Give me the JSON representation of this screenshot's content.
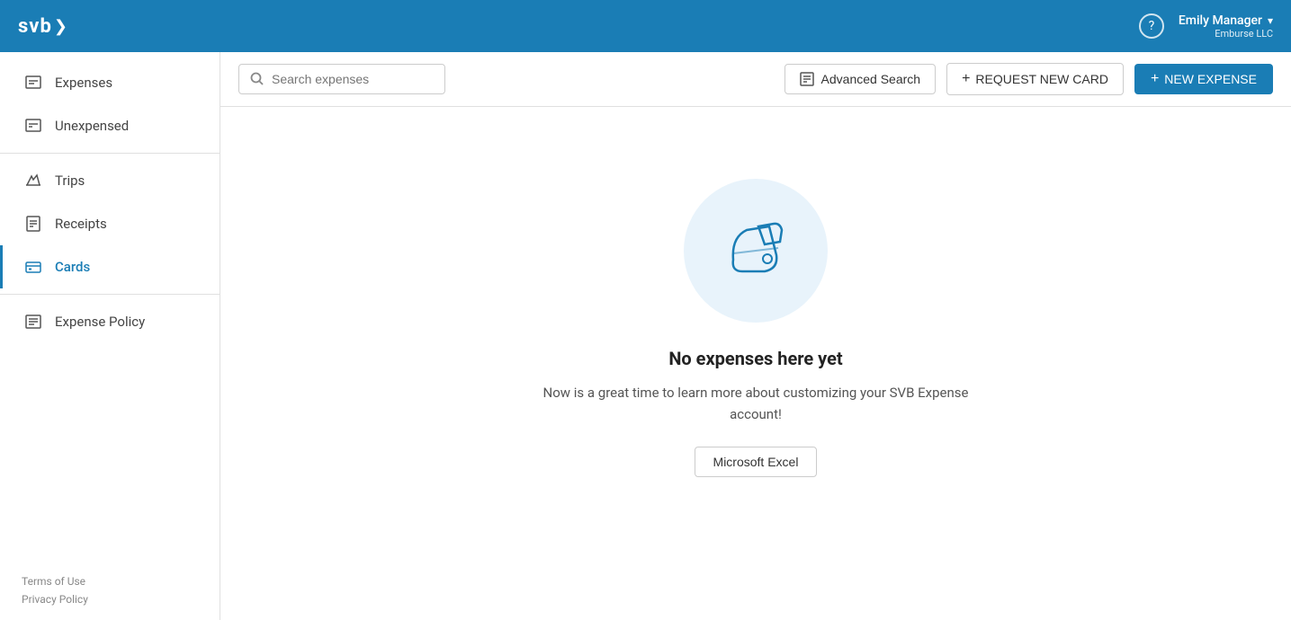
{
  "app": {
    "logo": "svb",
    "logo_chevron": "❯"
  },
  "topnav": {
    "help_label": "?",
    "user_name": "Emily Manager",
    "user_dropdown_arrow": "▾",
    "user_company": "Emburse LLC"
  },
  "sidebar": {
    "items": [
      {
        "id": "expenses",
        "label": "Expenses",
        "icon": "expense-icon",
        "active": false
      },
      {
        "id": "unexpensed",
        "label": "Unexpensed",
        "icon": "unexpensed-icon",
        "active": false
      },
      {
        "id": "trips",
        "label": "Trips",
        "icon": "trips-icon",
        "active": false
      },
      {
        "id": "receipts",
        "label": "Receipts",
        "icon": "receipts-icon",
        "active": false
      },
      {
        "id": "cards",
        "label": "Cards",
        "icon": "cards-icon",
        "active": true
      },
      {
        "id": "expense-policy",
        "label": "Expense Policy",
        "icon": "policy-icon",
        "active": false
      }
    ],
    "footer_links": [
      {
        "id": "terms",
        "label": "Terms of Use"
      },
      {
        "id": "privacy",
        "label": "Privacy Policy"
      }
    ]
  },
  "toolbar": {
    "search_placeholder": "Search expenses",
    "advanced_search_label": "Advanced Search",
    "request_card_label": "REQUEST NEW CARD",
    "new_expense_label": "NEW EXPENSE"
  },
  "main": {
    "empty_state": {
      "title": "No expenses here yet",
      "subtitle": "Now is a great time to learn more about customizing your SVB Expense account!",
      "excel_button_label": "Microsoft Excel"
    }
  }
}
